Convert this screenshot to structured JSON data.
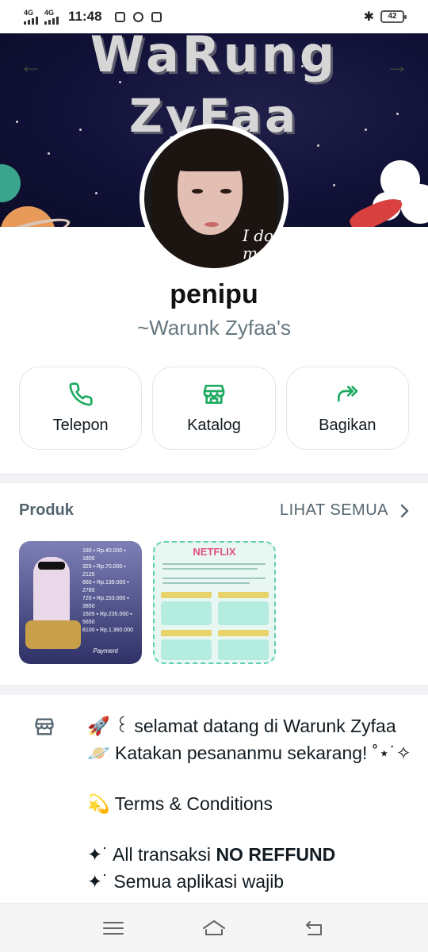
{
  "status_bar": {
    "network1": "4G",
    "network2": "4G",
    "time": "11:48",
    "battery": "42"
  },
  "cover": {
    "title_line1": "WaRung",
    "title_line2": "ZyFaa"
  },
  "avatar": {
    "overlay_text_line1": "I do",
    "overlay_text_line2": "me"
  },
  "profile": {
    "name": "penipu",
    "about": "~Warunk Zyfaa's"
  },
  "actions": [
    {
      "label": "Telepon",
      "icon": "phone-icon"
    },
    {
      "label": "Katalog",
      "icon": "store-icon"
    },
    {
      "label": "Bagikan",
      "icon": "share-icon"
    }
  ],
  "products": {
    "title": "Produk",
    "see_all": "LIHAT SEMUA",
    "items": [
      {
        "name": "product-game-topup",
        "label_line": "Payment"
      },
      {
        "name": "product-netflix",
        "label_line": "NETFLIX"
      }
    ]
  },
  "description": {
    "line1": "🚀 ꒰ selamat datang di Warunk Zyfaa 🪐 Katakan pesananmu sekarang! ˚⋆˙✧",
    "line2": "💫 Terms & Conditions",
    "line3_prefix": "✦˙ All transaksi ",
    "line3_bold": "NO REFFUND",
    "line4": "✦˙ Semua aplikasi wajib"
  },
  "colors": {
    "accent": "#1daa61",
    "muted": "#667781",
    "divider": "#f0f2f5"
  }
}
